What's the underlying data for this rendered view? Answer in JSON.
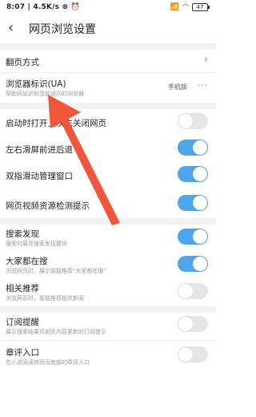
{
  "status_bar": {
    "time": "8:07",
    "speed": "4.5K/s",
    "battery": "47"
  },
  "header": {
    "back_icon": "chevron-left-icon",
    "title": "网页浏览设置"
  },
  "settings": [
    {
      "title": "翻页方式",
      "type": "chevron"
    },
    {
      "title": "浏览器标识(UA)",
      "subtitle": "帮助网站识别当前访问的浏览器",
      "value": "手机版",
      "type": "more"
    },
    {
      "title": "启动时打开上次未关闭网页",
      "type": "toggle",
      "on": false
    },
    {
      "title": "左右滑屏前进后退",
      "type": "toggle",
      "on": true
    },
    {
      "title": "双指滑动管理窗口",
      "type": "toggle",
      "on": true
    },
    {
      "title": "网页视频资源检测提示",
      "type": "toggle",
      "on": true
    },
    {
      "title": "搜索发现",
      "subtitle": "搜索时展现搜索发现模块",
      "type": "toggle",
      "on": true
    },
    {
      "title": "大家都在搜",
      "subtitle": "浏览网页时，展示智能推荐\"大家都在搜\"",
      "type": "toggle",
      "on": true
    },
    {
      "title": "相关推荐",
      "subtitle": "浏览网页时，智能推荐相关新闻",
      "type": "toggle",
      "on": false
    },
    {
      "title": "订阅提醒",
      "subtitle": "展示搜索结果页相关内容更新的订阅提示",
      "type": "toggle",
      "on": false
    },
    {
      "title": "章评入口",
      "subtitle": "在小说阅读转码页底部的章评入口",
      "type": "toggle",
      "on": false
    }
  ],
  "colors": {
    "toggle_on": "#4ea5e9",
    "toggle_off": "#e6e6e6",
    "annotation_arrow": "#f0563a"
  }
}
